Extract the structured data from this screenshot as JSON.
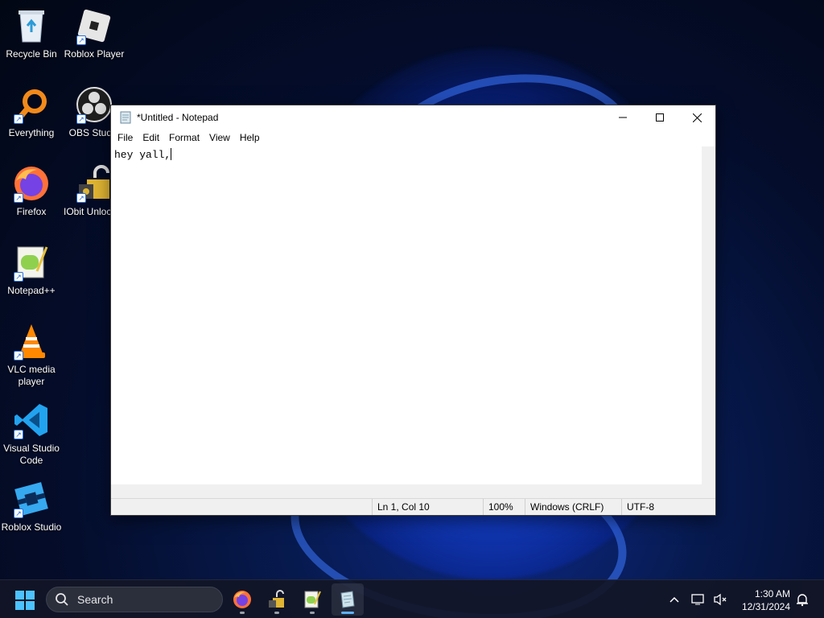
{
  "desktop": {
    "icons": [
      {
        "label": "Recycle Bin",
        "icon": "recycle-bin-icon"
      },
      {
        "label": "Roblox Player",
        "icon": "roblox-player-icon"
      },
      {
        "label": "Everything",
        "icon": "everything-search-icon"
      },
      {
        "label": "OBS Studio",
        "icon": "obs-studio-icon"
      },
      {
        "label": "Firefox",
        "icon": "firefox-icon"
      },
      {
        "label": "IObit Unlocker",
        "icon": "iobit-unlocker-icon"
      },
      {
        "label": "Notepad++",
        "icon": "notepad-plus-plus-icon"
      },
      {
        "label": "VLC media player",
        "icon": "vlc-icon"
      },
      {
        "label": "Visual Studio Code",
        "icon": "vscode-icon"
      },
      {
        "label": "Roblox Studio",
        "icon": "roblox-studio-icon"
      }
    ]
  },
  "notepad": {
    "title": "*Untitled - Notepad",
    "menu": [
      "File",
      "Edit",
      "Format",
      "View",
      "Help"
    ],
    "content": "hey yall,",
    "status": {
      "position": "Ln 1, Col 10",
      "zoom": "100%",
      "line_endings": "Windows (CRLF)",
      "encoding": "UTF-8"
    }
  },
  "taskbar": {
    "search_placeholder": "Search",
    "apps": [
      "firefox-icon",
      "iobit-unlocker-icon",
      "notepad-plus-plus-icon",
      "notepad-icon"
    ],
    "active_app": "notepad-icon",
    "clock": {
      "time": "1:30 AM",
      "date": "12/31/2024"
    }
  },
  "colors": {
    "accent": "#5fb2ff",
    "taskbar": "#12162a"
  }
}
